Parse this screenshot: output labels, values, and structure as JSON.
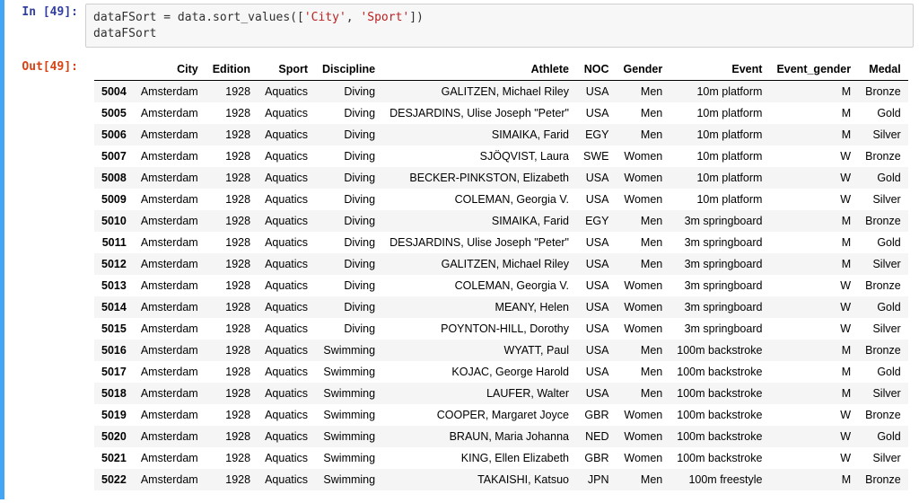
{
  "prompts": {
    "in": "In [49]:",
    "out": "Out[49]:"
  },
  "code": {
    "pre1": "dataFSort = data.sort_values([",
    "str1": "'City'",
    "sep": ", ",
    "str2": "'Sport'",
    "post": "])",
    "line2": "dataFSort"
  },
  "columns": [
    "City",
    "Edition",
    "Sport",
    "Discipline",
    "Athlete",
    "NOC",
    "Gender",
    "Event",
    "Event_gender",
    "Medal"
  ],
  "rows": [
    {
      "idx": "5004",
      "City": "Amsterdam",
      "Edition": "1928",
      "Sport": "Aquatics",
      "Discipline": "Diving",
      "Athlete": "GALITZEN, Michael Riley",
      "NOC": "USA",
      "Gender": "Men",
      "Event": "10m platform",
      "Event_gender": "M",
      "Medal": "Bronze"
    },
    {
      "idx": "5005",
      "City": "Amsterdam",
      "Edition": "1928",
      "Sport": "Aquatics",
      "Discipline": "Diving",
      "Athlete": "DESJARDINS, Ulise Joseph \"Peter\"",
      "NOC": "USA",
      "Gender": "Men",
      "Event": "10m platform",
      "Event_gender": "M",
      "Medal": "Gold"
    },
    {
      "idx": "5006",
      "City": "Amsterdam",
      "Edition": "1928",
      "Sport": "Aquatics",
      "Discipline": "Diving",
      "Athlete": "SIMAIKA, Farid",
      "NOC": "EGY",
      "Gender": "Men",
      "Event": "10m platform",
      "Event_gender": "M",
      "Medal": "Silver"
    },
    {
      "idx": "5007",
      "City": "Amsterdam",
      "Edition": "1928",
      "Sport": "Aquatics",
      "Discipline": "Diving",
      "Athlete": "SJÖQVIST, Laura",
      "NOC": "SWE",
      "Gender": "Women",
      "Event": "10m platform",
      "Event_gender": "W",
      "Medal": "Bronze"
    },
    {
      "idx": "5008",
      "City": "Amsterdam",
      "Edition": "1928",
      "Sport": "Aquatics",
      "Discipline": "Diving",
      "Athlete": "BECKER-PINKSTON, Elizabeth",
      "NOC": "USA",
      "Gender": "Women",
      "Event": "10m platform",
      "Event_gender": "W",
      "Medal": "Gold"
    },
    {
      "idx": "5009",
      "City": "Amsterdam",
      "Edition": "1928",
      "Sport": "Aquatics",
      "Discipline": "Diving",
      "Athlete": "COLEMAN, Georgia V.",
      "NOC": "USA",
      "Gender": "Women",
      "Event": "10m platform",
      "Event_gender": "W",
      "Medal": "Silver"
    },
    {
      "idx": "5010",
      "City": "Amsterdam",
      "Edition": "1928",
      "Sport": "Aquatics",
      "Discipline": "Diving",
      "Athlete": "SIMAIKA, Farid",
      "NOC": "EGY",
      "Gender": "Men",
      "Event": "3m springboard",
      "Event_gender": "M",
      "Medal": "Bronze"
    },
    {
      "idx": "5011",
      "City": "Amsterdam",
      "Edition": "1928",
      "Sport": "Aquatics",
      "Discipline": "Diving",
      "Athlete": "DESJARDINS, Ulise Joseph \"Peter\"",
      "NOC": "USA",
      "Gender": "Men",
      "Event": "3m springboard",
      "Event_gender": "M",
      "Medal": "Gold"
    },
    {
      "idx": "5012",
      "City": "Amsterdam",
      "Edition": "1928",
      "Sport": "Aquatics",
      "Discipline": "Diving",
      "Athlete": "GALITZEN, Michael Riley",
      "NOC": "USA",
      "Gender": "Men",
      "Event": "3m springboard",
      "Event_gender": "M",
      "Medal": "Silver"
    },
    {
      "idx": "5013",
      "City": "Amsterdam",
      "Edition": "1928",
      "Sport": "Aquatics",
      "Discipline": "Diving",
      "Athlete": "COLEMAN, Georgia V.",
      "NOC": "USA",
      "Gender": "Women",
      "Event": "3m springboard",
      "Event_gender": "W",
      "Medal": "Bronze"
    },
    {
      "idx": "5014",
      "City": "Amsterdam",
      "Edition": "1928",
      "Sport": "Aquatics",
      "Discipline": "Diving",
      "Athlete": "MEANY, Helen",
      "NOC": "USA",
      "Gender": "Women",
      "Event": "3m springboard",
      "Event_gender": "W",
      "Medal": "Gold"
    },
    {
      "idx": "5015",
      "City": "Amsterdam",
      "Edition": "1928",
      "Sport": "Aquatics",
      "Discipline": "Diving",
      "Athlete": "POYNTON-HILL, Dorothy",
      "NOC": "USA",
      "Gender": "Women",
      "Event": "3m springboard",
      "Event_gender": "W",
      "Medal": "Silver"
    },
    {
      "idx": "5016",
      "City": "Amsterdam",
      "Edition": "1928",
      "Sport": "Aquatics",
      "Discipline": "Swimming",
      "Athlete": "WYATT, Paul",
      "NOC": "USA",
      "Gender": "Men",
      "Event": "100m backstroke",
      "Event_gender": "M",
      "Medal": "Bronze"
    },
    {
      "idx": "5017",
      "City": "Amsterdam",
      "Edition": "1928",
      "Sport": "Aquatics",
      "Discipline": "Swimming",
      "Athlete": "KOJAC, George Harold",
      "NOC": "USA",
      "Gender": "Men",
      "Event": "100m backstroke",
      "Event_gender": "M",
      "Medal": "Gold"
    },
    {
      "idx": "5018",
      "City": "Amsterdam",
      "Edition": "1928",
      "Sport": "Aquatics",
      "Discipline": "Swimming",
      "Athlete": "LAUFER, Walter",
      "NOC": "USA",
      "Gender": "Men",
      "Event": "100m backstroke",
      "Event_gender": "M",
      "Medal": "Silver"
    },
    {
      "idx": "5019",
      "City": "Amsterdam",
      "Edition": "1928",
      "Sport": "Aquatics",
      "Discipline": "Swimming",
      "Athlete": "COOPER, Margaret Joyce",
      "NOC": "GBR",
      "Gender": "Women",
      "Event": "100m backstroke",
      "Event_gender": "W",
      "Medal": "Bronze"
    },
    {
      "idx": "5020",
      "City": "Amsterdam",
      "Edition": "1928",
      "Sport": "Aquatics",
      "Discipline": "Swimming",
      "Athlete": "BRAUN, Maria Johanna",
      "NOC": "NED",
      "Gender": "Women",
      "Event": "100m backstroke",
      "Event_gender": "W",
      "Medal": "Gold"
    },
    {
      "idx": "5021",
      "City": "Amsterdam",
      "Edition": "1928",
      "Sport": "Aquatics",
      "Discipline": "Swimming",
      "Athlete": "KING, Ellen Elizabeth",
      "NOC": "GBR",
      "Gender": "Women",
      "Event": "100m backstroke",
      "Event_gender": "W",
      "Medal": "Silver"
    },
    {
      "idx": "5022",
      "City": "Amsterdam",
      "Edition": "1928",
      "Sport": "Aquatics",
      "Discipline": "Swimming",
      "Athlete": "TAKAISHI, Katsuo",
      "NOC": "JPN",
      "Gender": "Men",
      "Event": "100m freestyle",
      "Event_gender": "M",
      "Medal": "Bronze"
    }
  ]
}
